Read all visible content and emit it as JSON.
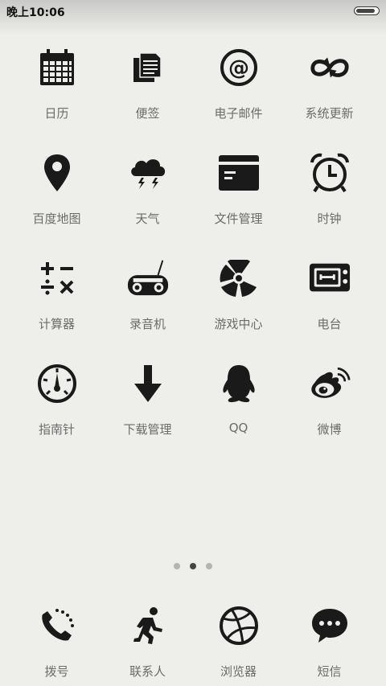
{
  "status_bar": {
    "time": "晚上10:06",
    "battery_level": 0.9
  },
  "apps": [
    {
      "label": "日历",
      "icon": "calendar-icon"
    },
    {
      "label": "便签",
      "icon": "notes-icon"
    },
    {
      "label": "电子邮件",
      "icon": "email-icon"
    },
    {
      "label": "系统更新",
      "icon": "update-icon"
    },
    {
      "label": "百度地图",
      "icon": "map-pin-icon"
    },
    {
      "label": "天气",
      "icon": "weather-icon"
    },
    {
      "label": "文件管理",
      "icon": "file-manager-icon"
    },
    {
      "label": "时钟",
      "icon": "alarm-clock-icon"
    },
    {
      "label": "计算器",
      "icon": "calculator-icon"
    },
    {
      "label": "录音机",
      "icon": "recorder-icon"
    },
    {
      "label": "游戏中心",
      "icon": "game-center-icon"
    },
    {
      "label": "电台",
      "icon": "radio-icon"
    },
    {
      "label": "指南针",
      "icon": "compass-icon"
    },
    {
      "label": "下载管理",
      "icon": "download-icon"
    },
    {
      "label": "QQ",
      "icon": "qq-icon"
    },
    {
      "label": "微博",
      "icon": "weibo-icon"
    }
  ],
  "pager": {
    "pages": 3,
    "current": 2
  },
  "dock": [
    {
      "label": "拨号",
      "icon": "phone-icon"
    },
    {
      "label": "联系人",
      "icon": "contacts-icon"
    },
    {
      "label": "浏览器",
      "icon": "browser-icon"
    },
    {
      "label": "短信",
      "icon": "message-icon"
    }
  ]
}
